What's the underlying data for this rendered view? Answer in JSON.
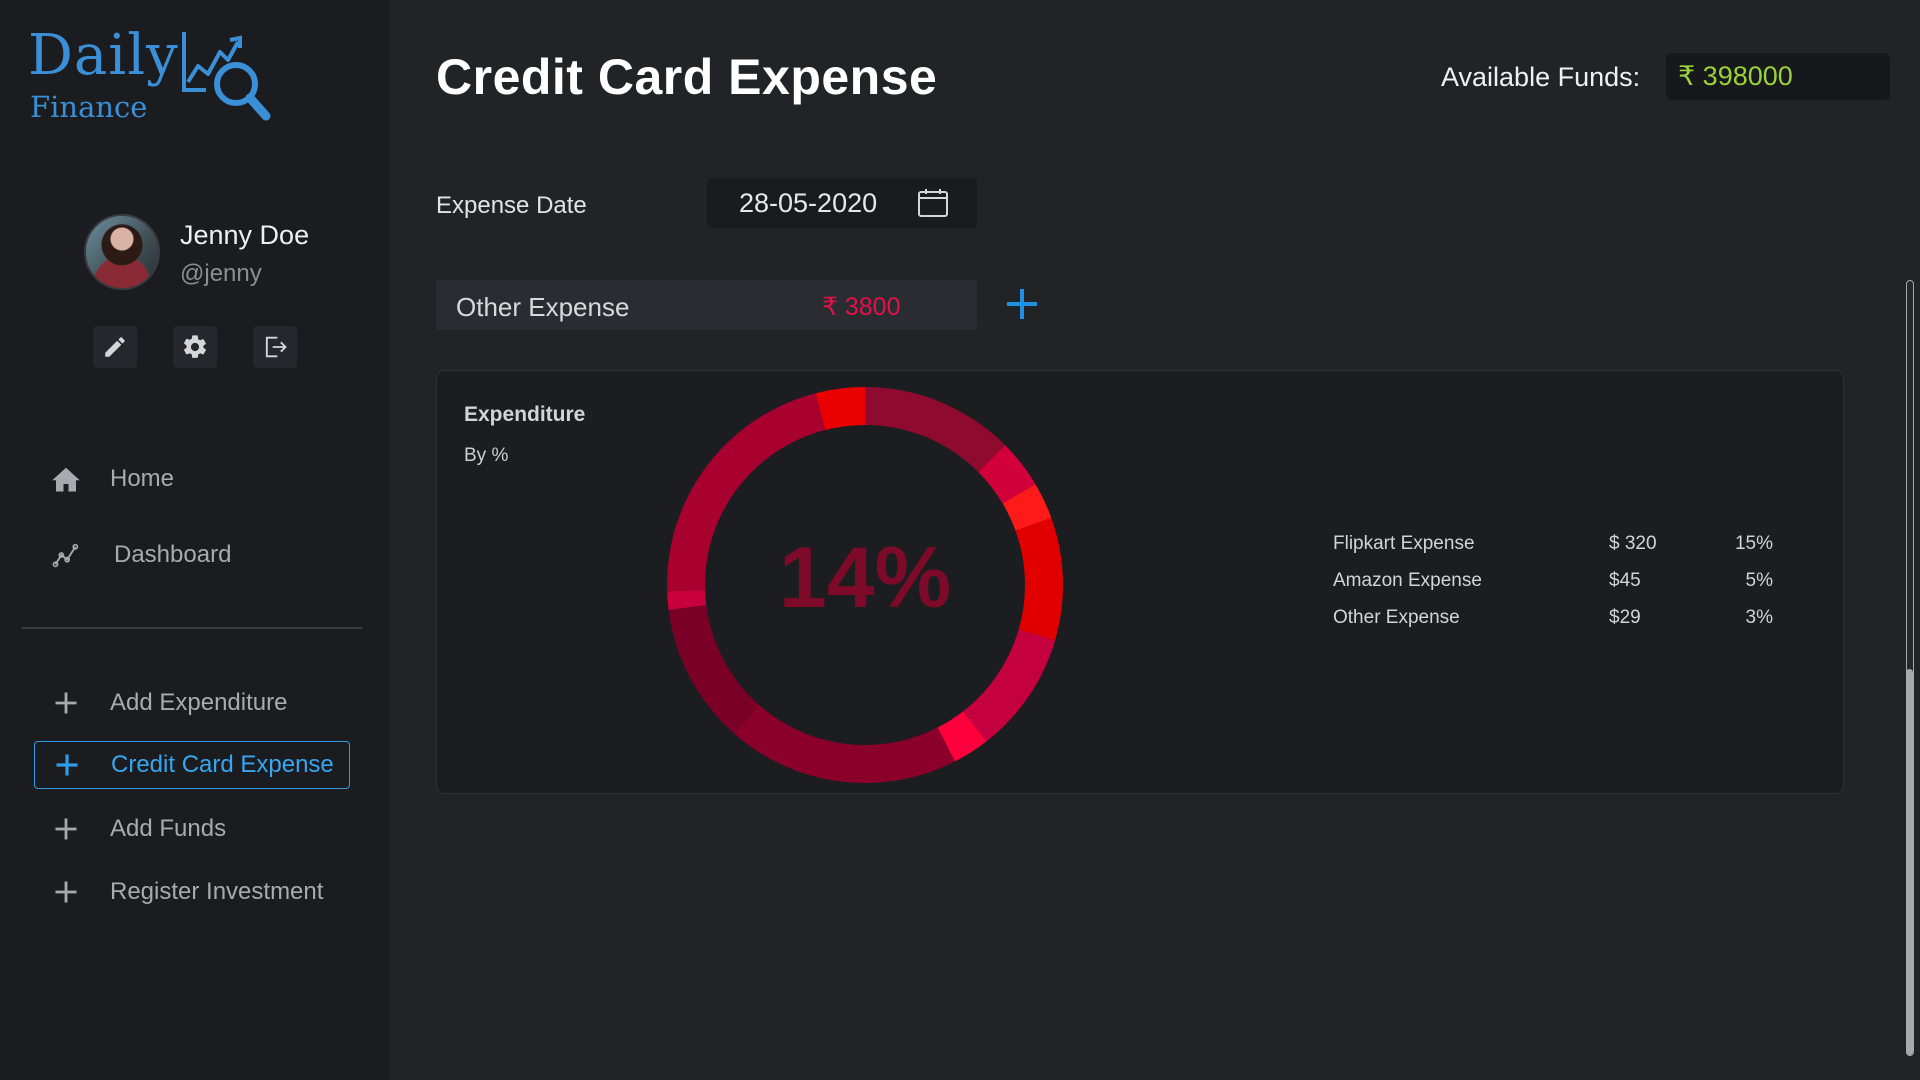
{
  "app": {
    "logo_word": "Daily",
    "logo_sub": "Finance",
    "accent_color": "#3a8fd6"
  },
  "profile": {
    "name": "Jenny Doe",
    "handle": "@jenny",
    "actions": [
      {
        "name": "edit-icon"
      },
      {
        "name": "gear-icon"
      },
      {
        "name": "logout-icon"
      }
    ]
  },
  "sidebar": {
    "nav": [
      {
        "label": "Home",
        "icon": "home-icon"
      },
      {
        "label": "Dashboard",
        "icon": "chart-line-icon"
      }
    ],
    "actions": [
      {
        "label": "Add Expenditure",
        "icon": "plus-icon",
        "active": false
      },
      {
        "label": "Credit Card Expense",
        "icon": "plus-icon",
        "active": true
      },
      {
        "label": "Add Funds",
        "icon": "plus-icon",
        "active": false
      },
      {
        "label": "Register Investment",
        "icon": "plus-icon",
        "active": false
      }
    ]
  },
  "header": {
    "title": "Credit Card Expense",
    "funds_label": "Available Funds:",
    "funds_value": "₹ 398000",
    "funds_color": "#9bd23a"
  },
  "form": {
    "date_label": "Expense Date",
    "date_value": "28-05-2020",
    "expense_label": "Other Expense",
    "expense_amount": "₹ 3800",
    "expense_amount_color": "#e0124a"
  },
  "chart_data": {
    "type": "pie",
    "title": "Expenditure",
    "subtitle": "By %",
    "center_label": "14%",
    "series": [
      {
        "name": "Flipkart Expense",
        "amount": "$ 320",
        "percent": "15%"
      },
      {
        "name": "Amazon Expense",
        "amount": "$45",
        "percent": "5%"
      },
      {
        "name": "Other Expense",
        "amount": "$29",
        "percent": "3%"
      }
    ],
    "segments": [
      {
        "value": 12.5,
        "color": "#8e0a2f"
      },
      {
        "value": 4,
        "color": "#d2003a"
      },
      {
        "value": 3,
        "color": "#ff1a1a"
      },
      {
        "value": 10,
        "color": "#e00000"
      },
      {
        "value": 10,
        "color": "#c4003e"
      },
      {
        "value": 3,
        "color": "#ff003c"
      },
      {
        "value": 19,
        "color": "#8a002a"
      },
      {
        "value": 11.5,
        "color": "#7a0027"
      },
      {
        "value": 1.5,
        "color": "#c8003e"
      },
      {
        "value": 21.5,
        "color": "#a8002f"
      },
      {
        "value": 4,
        "color": "#ea0000"
      }
    ]
  }
}
